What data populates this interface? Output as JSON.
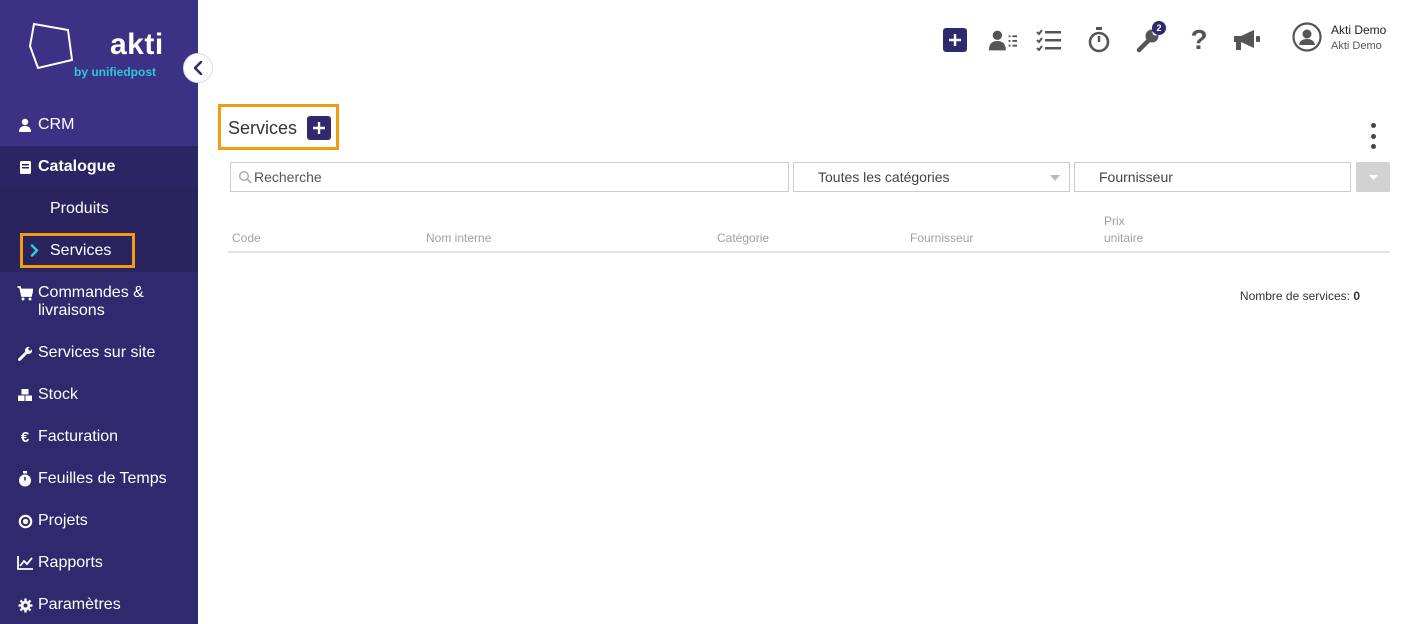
{
  "brand": {
    "name": "akti",
    "tagline": "by unifiedpost",
    "accent": "#2fc7d8",
    "sidebar_bg": "#2f2a6e",
    "highlight": "#f39c12"
  },
  "sidebar": {
    "items": [
      {
        "label": "CRM",
        "icon": "user-icon"
      },
      {
        "label": "Catalogue",
        "icon": "book-icon"
      },
      {
        "label": "Produits"
      },
      {
        "label": "Services"
      },
      {
        "label": "Commandes & livraisons",
        "icon": "cart-icon"
      },
      {
        "label": "Services sur site",
        "icon": "wrench-icon"
      },
      {
        "label": "Stock",
        "icon": "cubes-icon"
      },
      {
        "label": "Facturation",
        "icon": "euro-icon"
      },
      {
        "label": "Feuilles de Temps",
        "icon": "stopwatch-icon"
      },
      {
        "label": "Projets",
        "icon": "target-icon"
      },
      {
        "label": "Rapports",
        "icon": "chart-icon"
      },
      {
        "label": "Paramètres",
        "icon": "gear-icon"
      }
    ]
  },
  "topbar": {
    "notification_count": "2",
    "user_name": "Akti Demo",
    "user_company": "Akti Demo"
  },
  "page": {
    "title": "Services"
  },
  "filters": {
    "search_placeholder": "Recherche",
    "category": "Toutes les catégories",
    "supplier": "Fournisseur"
  },
  "table": {
    "headers": [
      "Code",
      "Nom interne",
      "Catégorie",
      "Fournisseur",
      "Prix",
      "unitaire"
    ]
  },
  "summary": {
    "label": "Nombre de services:",
    "count": "0"
  }
}
